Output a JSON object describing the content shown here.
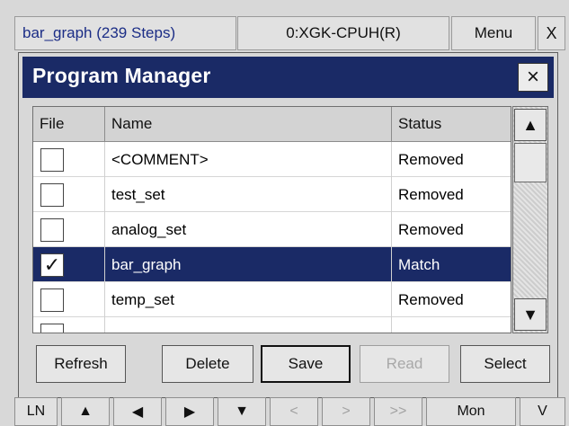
{
  "topbar": {
    "project": "bar_graph (239 Steps)",
    "cpu": "0:XGK-CPUH(R)",
    "menu": "Menu",
    "close": "X"
  },
  "dialog": {
    "title": "Program Manager",
    "close_symbol": "×"
  },
  "table": {
    "headers": {
      "file": "File",
      "name": "Name",
      "status": "Status"
    },
    "rows": [
      {
        "checked": false,
        "check_mark": "",
        "name": "<COMMENT>",
        "status": "Removed"
      },
      {
        "checked": false,
        "check_mark": "",
        "name": "test_set",
        "status": "Removed"
      },
      {
        "checked": false,
        "check_mark": "",
        "name": "analog_set",
        "status": "Removed"
      },
      {
        "checked": true,
        "check_mark": "✓",
        "name": "bar_graph",
        "status": "Match"
      },
      {
        "checked": false,
        "check_mark": "",
        "name": "temp_set",
        "status": "Removed"
      }
    ]
  },
  "scroll": {
    "up": "▲",
    "down": "▼"
  },
  "buttons": {
    "refresh": "Refresh",
    "delete": "Delete",
    "save": "Save",
    "read": "Read",
    "select": "Select"
  },
  "bottombar": {
    "ln": "LN",
    "up": "▲",
    "left": "◀",
    "right": "▶",
    "down": "▼",
    "lt": "<",
    "gt": ">",
    "ff": ">>",
    "mon": "Mon",
    "v": "V"
  },
  "colors": {
    "title_bar": "#1a2a66",
    "selection": "#1a2a66",
    "project_text": "#1b2d86"
  }
}
